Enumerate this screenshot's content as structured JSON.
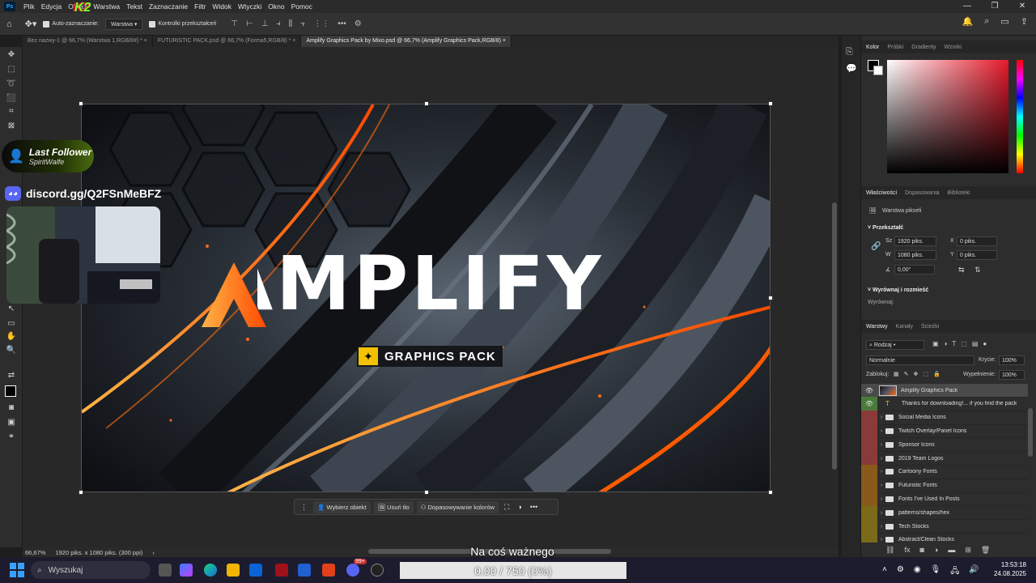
{
  "menubar": {
    "app_icon": "Ps",
    "items": [
      "Plik",
      "Edycja",
      "Obraz",
      "Warstwa",
      "Tekst",
      "Zaznaczanie",
      "Filtr",
      "Widok",
      "Wtyczki",
      "Okno",
      "Pomoc"
    ],
    "overlay_logo": "K2"
  },
  "optionsbar": {
    "auto_select_label": "Auto-zaznaczanie:",
    "auto_select_target": "Warstwa",
    "transform_controls_label": "Kontrolki przekształceń"
  },
  "tabs": [
    {
      "label": "Bez nazwy-1 @ 66,7% (Warstwa 1,RGB/8#) *",
      "active": false
    },
    {
      "label": "FUTURISTIC PACK.psd @ 66,7% (Forma5,RGB/8) *",
      "active": false
    },
    {
      "label": "Amplify Graphics Pack by Mixo.psd @ 66,7% (Amplify Graphics Pack,RGB/8)",
      "active": true
    }
  ],
  "tab_close": "×",
  "artboard": {
    "title": "AMPLIFY",
    "subtitle": "GRAPHICS PACK"
  },
  "stream_overlay": {
    "follower_title": "Last Follower",
    "follower_name": "SpiritWalfe",
    "discord_link": "discord.gg/Q2FSnMeBFZ"
  },
  "context_bar": {
    "select_subject": "Wybierz obiekt",
    "remove_bg": "Usuń tło",
    "color_match": "Dopasowywanie kolorów"
  },
  "status": {
    "zoom": "66,67%",
    "dimensions": "1920 piks. x 1080 piks. (300 ppi)"
  },
  "color_panel": {
    "tabs": [
      "Kolor",
      "Próbki",
      "Gradienty",
      "Wzorki"
    ],
    "active_tab": "Kolor",
    "hue_color": "#e6192b"
  },
  "properties_panel": {
    "tabs": [
      "Właściwości",
      "Dopasowania",
      "Biblioteki"
    ],
    "layer_type": "Warstwa pikseli",
    "transform_title": "Przekształć",
    "w_label": "Sz",
    "w_value": "1920 piks.",
    "h_label": "W",
    "h_value": "1080 piks.",
    "x_label": "X",
    "x_value": "0 piks.",
    "y_label": "Y",
    "y_value": "0 piks.",
    "angle_value": "0,00°",
    "align_title": "Wyrównaj i rozmieść",
    "align_label": "Wyrównaj:"
  },
  "layers_panel": {
    "tabs": [
      "Warstwy",
      "Kanały",
      "Ścieżki"
    ],
    "filter_kind": "Rodzaj",
    "blend_mode": "Normalnie",
    "opacity_label": "Krycie:",
    "opacity_value": "100%",
    "lock_label": "Zablokuj:",
    "fill_label": "Wypełnienie:",
    "fill_value": "100%",
    "layers": [
      {
        "name": "Amplify Graphics Pack",
        "type": "pixel",
        "color": "none",
        "visible": true,
        "selected": true
      },
      {
        "name": "Thanks for downloading!... if you find the pack",
        "type": "text",
        "color": "green",
        "visible": true,
        "selected": false
      },
      {
        "name": "Social Media Icons",
        "type": "group",
        "color": "red",
        "visible": false,
        "selected": false
      },
      {
        "name": "Twitch Overlay/Panel Icons",
        "type": "group",
        "color": "red",
        "visible": false,
        "selected": false
      },
      {
        "name": "Sponsor Icons",
        "type": "group",
        "color": "red",
        "visible": false,
        "selected": false
      },
      {
        "name": "2019 Team Logos",
        "type": "group",
        "color": "red",
        "visible": false,
        "selected": false
      },
      {
        "name": "Cartoony Fonts",
        "type": "group",
        "color": "orange",
        "visible": false,
        "selected": false
      },
      {
        "name": "Futuristic Fonts",
        "type": "group",
        "color": "orange",
        "visible": false,
        "selected": false
      },
      {
        "name": "Fonts I've Used In Posts",
        "type": "group",
        "color": "orange",
        "visible": false,
        "selected": false
      },
      {
        "name": "patterns/shapes/hex",
        "type": "group",
        "color": "yellow",
        "visible": false,
        "selected": false
      },
      {
        "name": "Tech Stocks",
        "type": "group",
        "color": "yellow",
        "visible": false,
        "selected": false
      },
      {
        "name": "Abstract/Clean Stocks",
        "type": "group",
        "color": "yellow",
        "visible": false,
        "selected": false
      }
    ]
  },
  "taskbar": {
    "search_placeholder": "Wyszukaj",
    "clock_time": "13:53:18",
    "clock_date": "24.08.2025",
    "badge": "99+"
  },
  "video_overlay": {
    "caption": "Na coś ważnego",
    "progress_text": "0.00 / 750 (0%)",
    "progress_fraction": 0
  }
}
